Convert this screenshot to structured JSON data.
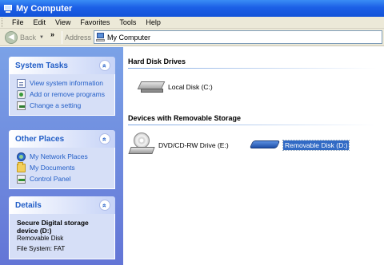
{
  "window": {
    "title": "My Computer"
  },
  "menu": [
    "File",
    "Edit",
    "View",
    "Favorites",
    "Tools",
    "Help"
  ],
  "toolbar": {
    "back_label": "Back",
    "chevron": "»",
    "address_label": "Address",
    "address_value": "My Computer"
  },
  "sidebar": {
    "system_tasks": {
      "title": "System Tasks",
      "collapse_glyph": "«",
      "items": [
        "View system information",
        "Add or remove programs",
        "Change a setting"
      ]
    },
    "other_places": {
      "title": "Other Places",
      "collapse_glyph": "«",
      "items": [
        "My Network Places",
        "My Documents",
        "Control Panel"
      ]
    },
    "details": {
      "title": "Details",
      "collapse_glyph": "«",
      "name": "Secure Digital storage device (D:)",
      "type": "Removable Disk",
      "fs": "File System: FAT"
    }
  },
  "content": {
    "hard_disk_header": "Hard Disk Drives",
    "removable_header": "Devices with Removable Storage",
    "local_disk": "Local Disk (C:)",
    "dvd_drive": "DVD/CD-RW Drive (E:)",
    "removable_disk": "Removable Disk (D:)"
  }
}
